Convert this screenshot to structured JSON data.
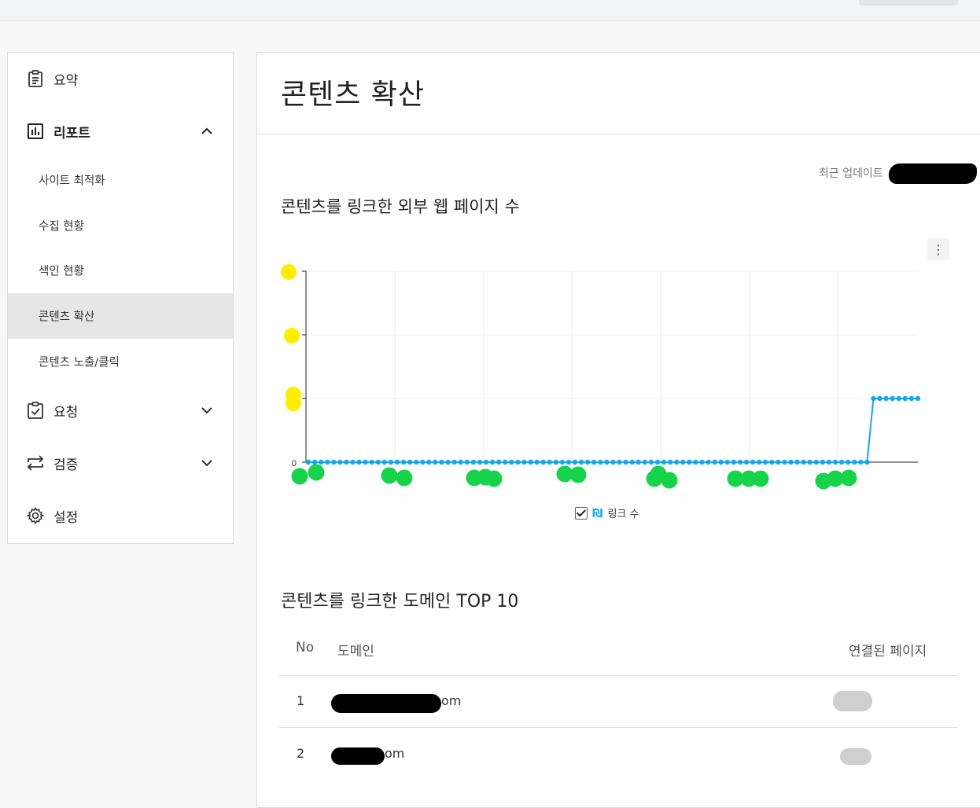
{
  "sidebar": {
    "summary_label": "요약",
    "report_label": "리포트",
    "report_sub": [
      "사이트 최적화",
      "수집 현황",
      "색인 현황",
      "콘텐츠 확산",
      "콘텐츠 노출/클릭"
    ],
    "request_label": "요청",
    "verify_label": "검증",
    "settings_label": "설정"
  },
  "main": {
    "title": "콘텐츠 확산",
    "update_label": "최근 업데이트",
    "chart_title": "콘텐츠를 링크한 외부 웹 페이지 수",
    "legend_label": "링크 수",
    "legend_icon": "₪",
    "table_title": "콘텐츠를 링크한 도메인 TOP 10",
    "table": {
      "headers": [
        "No",
        "도메인",
        "연결된 페이지"
      ],
      "rows": [
        {
          "no": "1",
          "domain_suffix": "om"
        },
        {
          "no": "2",
          "domain_suffix": "om"
        }
      ]
    }
  },
  "colors": {
    "accent": "#1aa5ef",
    "active_bg": "#e6e6e6"
  },
  "chart_data": {
    "type": "line",
    "series": [
      {
        "name": "링크 수",
        "values": [
          0,
          0,
          0,
          0,
          0,
          0,
          0,
          0,
          0,
          0,
          0,
          0,
          0,
          0,
          0,
          0,
          0,
          0,
          0,
          0,
          0,
          0,
          0,
          0,
          0,
          0,
          0,
          0,
          0,
          0,
          0,
          0,
          0,
          0,
          0,
          0,
          0,
          0,
          0,
          0,
          0,
          0,
          0,
          0,
          0,
          0,
          0,
          0,
          0,
          0,
          0,
          0,
          0,
          0,
          0,
          0,
          0,
          0,
          0,
          0,
          0,
          0,
          0,
          0,
          0,
          0,
          0,
          0,
          0,
          0,
          0,
          0,
          0,
          0,
          0,
          0,
          0,
          0,
          0,
          0,
          0,
          0,
          0,
          0,
          0,
          0,
          0,
          0,
          0,
          2,
          2,
          2,
          2,
          2,
          2,
          2,
          2
        ]
      }
    ],
    "y_tick_labels": [
      "0"
    ],
    "grid": true
  }
}
